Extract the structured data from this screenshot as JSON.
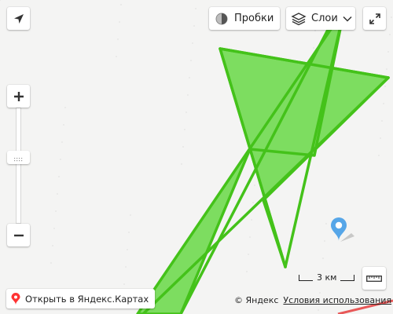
{
  "map": {
    "background_color": "#f4f4f3",
    "polygon_fill": "#7ddd60",
    "polygon_stroke": "#44c21a",
    "route_color": "#e85858"
  },
  "controls": {
    "geolocation_icon": "navigation-arrow-icon",
    "traffic_label": "Пробки",
    "traffic_icon": "traffic-light-icon",
    "layers_label": "Слои",
    "layers_icon": "layers-icon",
    "fullscreen_icon": "expand-icon",
    "zoom_in_icon": "plus-icon",
    "zoom_out_icon": "minus-icon",
    "ruler_icon": "ruler-icon"
  },
  "footer": {
    "open_in_maps_label": "Открыть в Яндекс.Картах",
    "scale_label": "3 км",
    "copyright": "© Яндекс",
    "terms_label": "Условия использования"
  },
  "marker": {
    "icon": "map-pin-icon",
    "color": "#56a6e8"
  }
}
